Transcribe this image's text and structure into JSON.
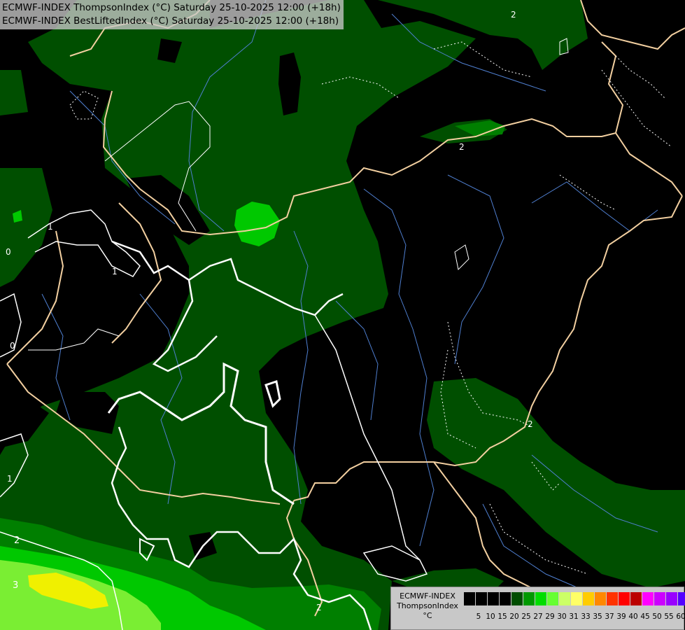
{
  "header": {
    "line1": "ECMWF-INDEX ThompsonIndex (°C) Saturday 25-10-2025 12:00 (+18h)",
    "line2": "ECMWF-INDEX BestLiftedIndex (°C) Saturday 25-10-2025 12:00 (+18h)"
  },
  "legend": {
    "title1": "ECMWF-INDEX",
    "title2": "ThompsonIndex",
    "unit": "°C",
    "colors": [
      "#000000",
      "#000000",
      "#000000",
      "#000000",
      "#004d00",
      "#009900",
      "#00dd00",
      "#66ff33",
      "#ccff66",
      "#ffff66",
      "#ffcc00",
      "#ff8800",
      "#ff3300",
      "#ff0000",
      "#bb0000",
      "#ff00ff",
      "#cc00ff",
      "#9900ff",
      "#5500ff",
      "#0000ff"
    ],
    "ticks": [
      "5",
      "10",
      "15",
      "20",
      "25",
      "27",
      "29",
      "30",
      "31",
      "33",
      "35",
      "37",
      "39",
      "40",
      "45",
      "50",
      "55",
      "60"
    ]
  },
  "contour_labels": [
    "2",
    "2",
    "1",
    "0",
    "1",
    "0",
    "1",
    "2",
    "3",
    "2",
    "2"
  ],
  "colors": {
    "dark_green": "#004f00",
    "mid_green": "#007f00",
    "bright_green": "#00c800",
    "lime": "#66ee33",
    "yellow": "#f0f000",
    "border": "#f2cfa0",
    "river": "#4f7fd0"
  }
}
